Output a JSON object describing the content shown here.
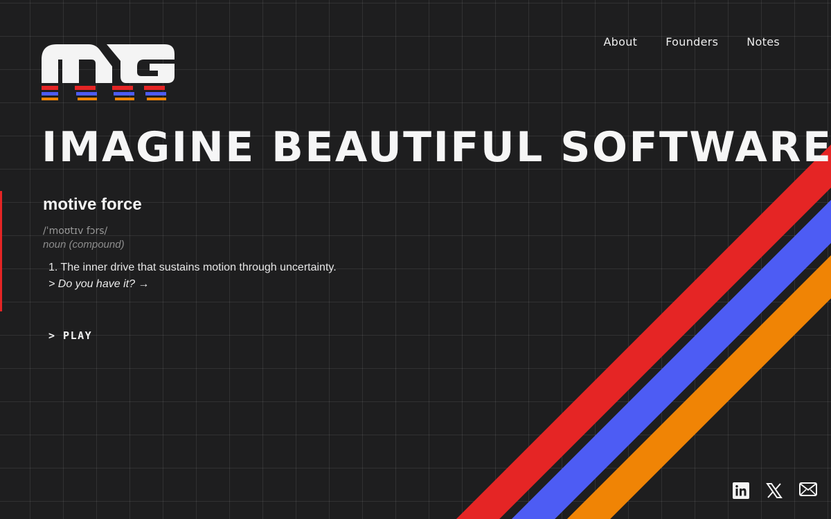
{
  "nav": {
    "items": [
      {
        "label": "About"
      },
      {
        "label": "Founders"
      },
      {
        "label": "Notes"
      }
    ]
  },
  "hero": {
    "headline": "IMAGINE BEAUTIFUL SOFTWARE"
  },
  "definition": {
    "term": "motive force",
    "pronunciation": "/ˈmoʊtɪv fɔrs/",
    "part_of_speech": "noun (compound)",
    "sense": "1. The inner drive that sustains motion through uncertainty.",
    "prompt_link": "> Do you have it? →"
  },
  "play": {
    "label": "> PLAY"
  },
  "colors": {
    "background": "#1e1e1f",
    "red": "#e52525",
    "blue": "#4d5cf4",
    "orange": "#f08405"
  },
  "social": {
    "icons": [
      "linkedin-icon",
      "x-icon",
      "mail-icon"
    ]
  },
  "logo": {
    "icon": "mg-logo"
  }
}
